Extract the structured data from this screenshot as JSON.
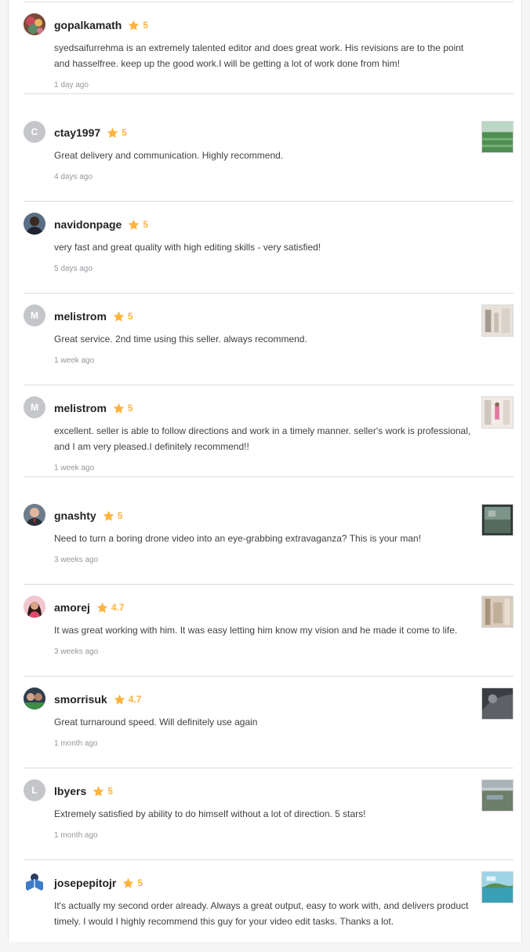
{
  "reviews": [
    {
      "username": "gopalkamath",
      "rating": "5",
      "comment": "syedsaifurrehma is an extremely talented editor and does great work. His revisions are to the point and hasselfree. keep up the good work.I will be getting a lot of work done from him!",
      "date": "1 day ago",
      "avatar_initial": ""
    },
    {
      "username": "ctay1997",
      "rating": "5",
      "comment": "Great delivery and communication. Highly recommend.",
      "date": "4 days ago",
      "avatar_initial": "C"
    },
    {
      "username": "navidonpage",
      "rating": "5",
      "comment": "very fast and great quality with high editing skills - very satisfied!",
      "date": "5 days ago",
      "avatar_initial": ""
    },
    {
      "username": "melistrom",
      "rating": "5",
      "comment": "Great service. 2nd time using this seller. always recommend.",
      "date": "1 week ago",
      "avatar_initial": "M"
    },
    {
      "username": "melistrom",
      "rating": "5",
      "comment": "excellent. seller is able to follow directions and work in a timely manner. seller's work is professional, and I am very pleased.I definitely recommend!!",
      "date": "1 week ago",
      "avatar_initial": "M"
    },
    {
      "username": "gnashty",
      "rating": "5",
      "comment": "Need to turn a boring drone video into an eye-grabbing extravaganza? This is your man!",
      "date": "3 weeks ago",
      "avatar_initial": ""
    },
    {
      "username": "amorej",
      "rating": "4.7",
      "comment": "It was great working with him. It was easy letting him know my vision and he made it come to life.",
      "date": "3 weeks ago",
      "avatar_initial": ""
    },
    {
      "username": "smorrisuk",
      "rating": "4.7",
      "comment": "Great turnaround speed. Will definitely use again",
      "date": "1 month ago",
      "avatar_initial": ""
    },
    {
      "username": "lbyers",
      "rating": "5",
      "comment": "Extremely satisfied by ability to do himself without a lot of direction. 5 stars!",
      "date": "1 month ago",
      "avatar_initial": "L"
    },
    {
      "username": "josepepitojr",
      "rating": "5",
      "comment": "It's actually my second order already. Always a great output, easy to work with, and delivers product timely. I would I highly recommend this guy for your video edit tasks. Thanks a lot.",
      "date": "",
      "avatar_initial": ""
    }
  ],
  "colors": {
    "star": "#ffb33e",
    "username": "#222325",
    "comment": "#404145",
    "date": "#95979d",
    "divider": "#dadbdd",
    "initial_avatar": "#c5c6c9"
  },
  "icons": {
    "star": "star-icon",
    "photo_avatar": "user-photo-avatar",
    "thumbnail": "delivery-thumbnail"
  }
}
